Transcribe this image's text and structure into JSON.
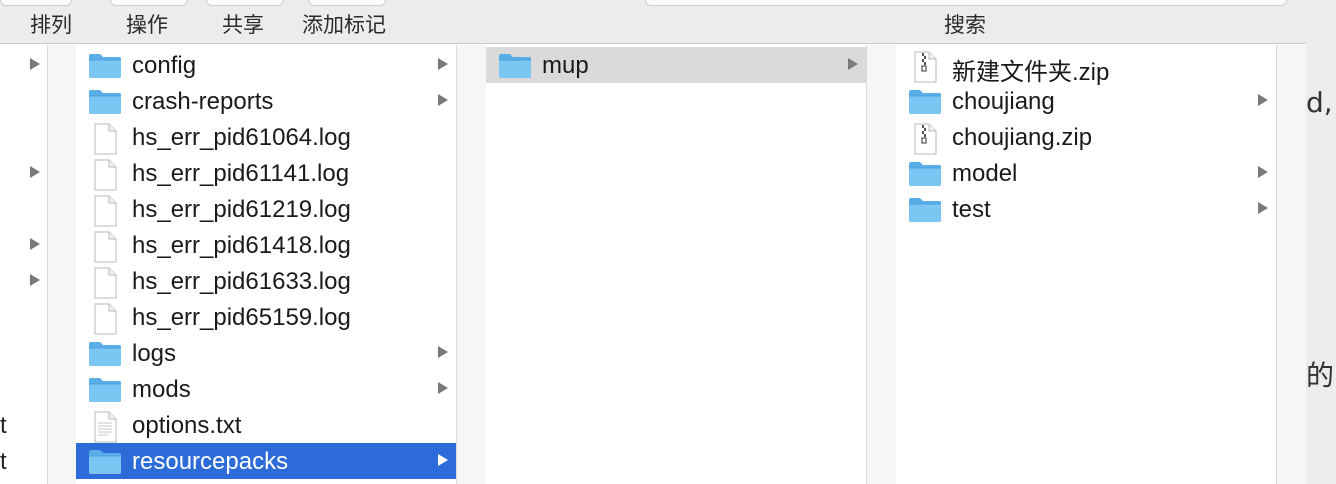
{
  "toolbar": {
    "sort": "排列",
    "action": "操作",
    "share": "共享",
    "add_tags": "添加标记",
    "search": "搜索"
  },
  "backdrop": {
    "fragment_1": "d,",
    "fragment_2": "的"
  },
  "column0": {
    "letters": [
      "t",
      "t"
    ]
  },
  "column1": {
    "items": [
      {
        "name": "config",
        "icon": "folder-icon",
        "has_children": true
      },
      {
        "name": "crash-reports",
        "icon": "folder-icon",
        "has_children": true
      },
      {
        "name": "hs_err_pid61064.log",
        "icon": "document-icon",
        "has_children": false
      },
      {
        "name": "hs_err_pid61141.log",
        "icon": "document-icon",
        "has_children": false
      },
      {
        "name": "hs_err_pid61219.log",
        "icon": "document-icon",
        "has_children": false
      },
      {
        "name": "hs_err_pid61418.log",
        "icon": "document-icon",
        "has_children": false
      },
      {
        "name": "hs_err_pid61633.log",
        "icon": "document-icon",
        "has_children": false
      },
      {
        "name": "hs_err_pid65159.log",
        "icon": "document-icon",
        "has_children": false
      },
      {
        "name": "logs",
        "icon": "folder-icon",
        "has_children": true
      },
      {
        "name": "mods",
        "icon": "folder-icon",
        "has_children": true
      },
      {
        "name": "options.txt",
        "icon": "text-file-icon",
        "has_children": false
      },
      {
        "name": "resourcepacks",
        "icon": "folder-icon",
        "has_children": true,
        "selected": true
      }
    ]
  },
  "column2": {
    "items": [
      {
        "name": "mup",
        "icon": "folder-icon",
        "has_children": true,
        "selected": true
      }
    ]
  },
  "column3": {
    "items": [
      {
        "name": "新建文件夹.zip",
        "icon": "zip-icon",
        "has_children": false
      },
      {
        "name": "choujiang",
        "icon": "folder-icon",
        "has_children": true
      },
      {
        "name": "choujiang.zip",
        "icon": "zip-icon",
        "has_children": false
      },
      {
        "name": "model",
        "icon": "folder-icon",
        "has_children": true
      },
      {
        "name": "test",
        "icon": "folder-icon",
        "has_children": true
      }
    ]
  },
  "colors": {
    "selection_active": "#2d6bd8",
    "selection_inactive": "#dadada",
    "folder": "#6cbdf0"
  }
}
